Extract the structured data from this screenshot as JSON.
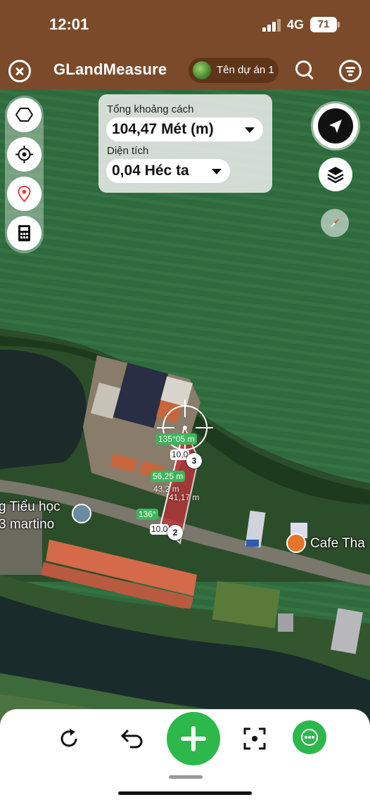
{
  "status_bar": {
    "time": "12:01",
    "network": "4G",
    "battery": "71"
  },
  "header": {
    "title": "GLandMeasure",
    "project_name": "Tên dự án 1"
  },
  "measurement": {
    "distance_label": "Tổng khoảng cách",
    "distance_value": "104,47 Mét (m)",
    "area_label": "Diện tích",
    "area_value": "0,04 Héc ta"
  },
  "left_tools": [
    {
      "icon": "polygon-icon"
    },
    {
      "icon": "crosshair-target-icon"
    },
    {
      "icon": "location-pin-icon"
    },
    {
      "icon": "calculator-icon"
    }
  ],
  "right_controls": [
    {
      "icon": "navigation-arrow-icon"
    },
    {
      "icon": "layers-icon"
    },
    {
      "icon": "compass-icon"
    }
  ],
  "map_labels": {
    "school": "g Tiểu học",
    "school_line2": "3 martino",
    "cafe": "Cafe Tha"
  },
  "polygon_labels": {
    "angle_top": "135°",
    "len_top": "05 m",
    "len_top_white": "10,0",
    "len_mid_green": "56,25 m",
    "len_mid1": "43,2 m",
    "len_mid2": "41,17 m",
    "angle_bottom": "136°",
    "len_bottom_white": "10,0",
    "vertex_3": "3",
    "vertex_2": "2"
  },
  "bottom_toolbar": [
    {
      "icon": "refresh-icon"
    },
    {
      "icon": "undo-icon"
    },
    {
      "icon": "add-icon"
    },
    {
      "icon": "focus-frame-icon"
    },
    {
      "icon": "more-icon"
    }
  ],
  "colors": {
    "header_brown": "#7a4a2a",
    "accent_green": "#2db84c",
    "polygon_red": "#c8323c",
    "field_green": "#2f6a3e"
  }
}
